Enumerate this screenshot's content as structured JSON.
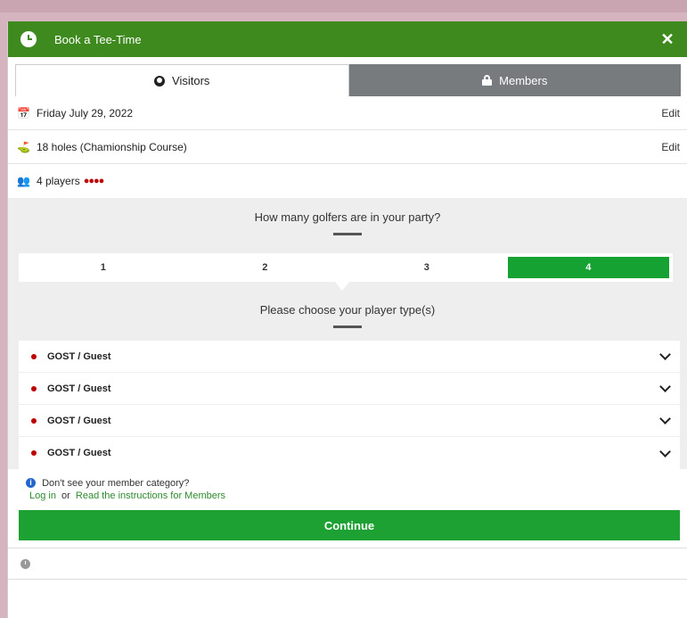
{
  "header": {
    "title": "Book a Tee-Time",
    "close": "✕"
  },
  "tabs": [
    {
      "label": "Visitors",
      "active": true
    },
    {
      "label": "Members",
      "active": false
    }
  ],
  "details": {
    "date": "Friday July 29, 2022",
    "course": "18 holes (Chamionship Course)",
    "players": "4 players",
    "player_dots": "●●●●",
    "edit_label": "Edit",
    "date_icon": "📅",
    "course_icon": "⛳",
    "players_icon": "👥"
  },
  "party": {
    "question": "How many golfers are in your party?",
    "options": [
      "1",
      "2",
      "3",
      "4"
    ],
    "selected": "4"
  },
  "player_types": {
    "prompt": "Please choose your player type(s)",
    "rows": [
      "GOST / Guest",
      "GOST / Guest",
      "GOST / Guest",
      "GOST / Guest"
    ]
  },
  "helper": {
    "info_glyph": "i",
    "text": "Don't see your member category?",
    "login_link": "Log in",
    "or_text": "or",
    "instructions_link": "Read the instructions for Members"
  },
  "actions": {
    "continue_label": "Continue"
  },
  "colors": {
    "header_green": "#3f8a1f",
    "selected_green": "#16a233",
    "continue_green": "#1da132",
    "tab_inactive": "#777b7e",
    "dot_red": "#bb0000"
  }
}
